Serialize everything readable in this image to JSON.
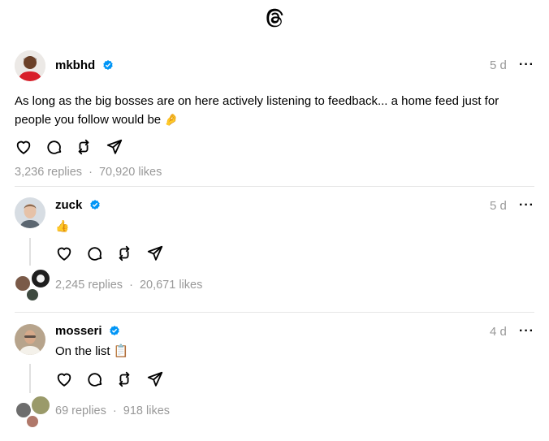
{
  "app": {
    "logo_icon": "threads-logo-icon"
  },
  "post": {
    "username": "mkbhd",
    "time": "5 d",
    "more": "···",
    "text": "As long as the big bosses are on here actively listening to feedback... a home feed just for people you follow would be",
    "emoji": "🤌",
    "replies": "3,236 replies",
    "sep": "·",
    "likes": "70,920 likes"
  },
  "replies": [
    {
      "username": "zuck",
      "time": "5 d",
      "more": "···",
      "text": "👍",
      "replies": "2,245 replies",
      "sep": "·",
      "likes": "20,671 likes"
    },
    {
      "username": "mosseri",
      "time": "4 d",
      "more": "···",
      "text": "On the list 📋",
      "replies": "69 replies",
      "sep": "·",
      "likes": "918 likes"
    }
  ],
  "colors": {
    "verified": "#0095f6",
    "muted": "#999999",
    "divider": "#e6e6e6"
  }
}
